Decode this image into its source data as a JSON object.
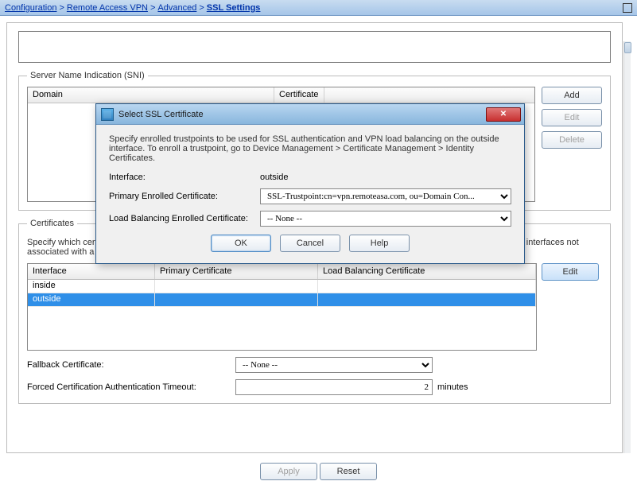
{
  "breadcrumb": {
    "a": "Configuration",
    "b": "Remote Access VPN",
    "c": "Advanced",
    "d": "SSL Settings"
  },
  "sni": {
    "legend": "Server Name Indication (SNI)",
    "col_domain": "Domain",
    "col_cert": "Certificate",
    "btn_add": "Add",
    "btn_edit": "Edit",
    "btn_delete": "Delete"
  },
  "certs": {
    "legend": "Certificates",
    "desc": "Specify which certificates, if any, should be used for SSL authentication on each interface. The fallback certificate will be used on interfaces not associated with a certificate of their own.",
    "col_iface": "Interface",
    "col_primary": "Primary Certificate",
    "col_lb": "Load Balancing Certificate",
    "btn_edit": "Edit",
    "rows": [
      {
        "iface": "inside",
        "primary": "",
        "lb": ""
      },
      {
        "iface": "outside",
        "primary": "",
        "lb": ""
      }
    ]
  },
  "fallback": {
    "label": "Fallback Certificate:",
    "value": "-- None --"
  },
  "forced": {
    "label": "Forced Certification Authentication Timeout:",
    "value": "2",
    "suffix": "minutes"
  },
  "footer": {
    "apply": "Apply",
    "reset": "Reset"
  },
  "dialog": {
    "title": "Select SSL Certificate",
    "desc": "Specify enrolled trustpoints to be used for SSL authentication and VPN load balancing on the outside interface. To enroll a trustpoint, go to Device Management > Certificate Management > Identity Certificates.",
    "iface_label": "Interface:",
    "iface_value": "outside",
    "primary_label": "Primary Enrolled Certificate:",
    "primary_value": "SSL-Trustpoint:cn=vpn.remoteasa.com, ou=Domain Con...",
    "lb_label": "Load Balancing Enrolled Certificate:",
    "lb_value": "-- None --",
    "ok": "OK",
    "cancel": "Cancel",
    "help": "Help"
  }
}
